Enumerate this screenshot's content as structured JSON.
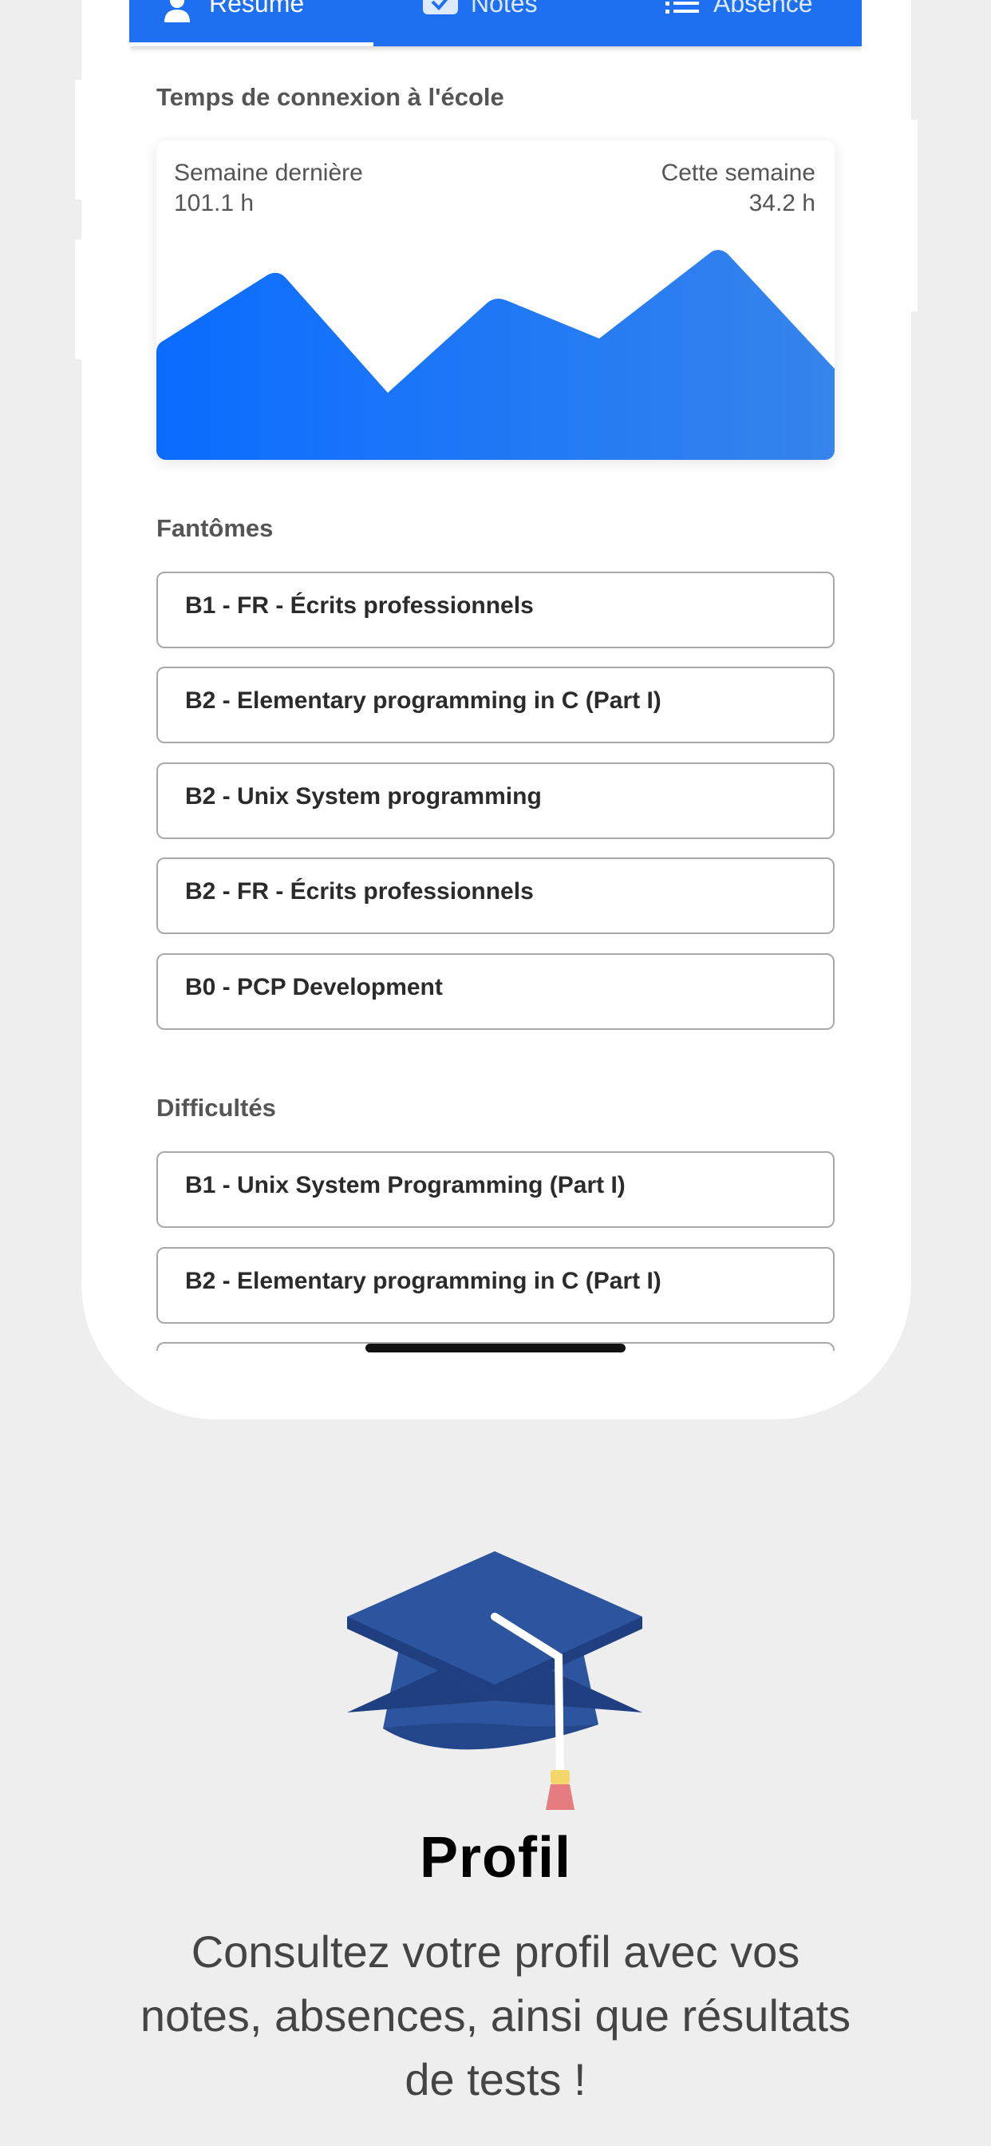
{
  "tabs": [
    {
      "label": "Résumé",
      "icon": "user-icon",
      "active": true
    },
    {
      "label": "Notes",
      "icon": "check-badge-icon",
      "active": false
    },
    {
      "label": "Absence",
      "icon": "list-icon",
      "active": false
    }
  ],
  "connection": {
    "title": "Temps de connexion à l'école",
    "last_week_label": "Semaine dernière",
    "last_week_value": "101.1 h",
    "this_week_label": "Cette semaine",
    "this_week_value": "34.2 h"
  },
  "fantomes": {
    "title": "Fantômes",
    "items": [
      "B1 - FR - Écrits professionnels",
      "B2 - Elementary programming in C (Part I)",
      "B2 - Unix System programming",
      "B2 - FR - Écrits professionnels",
      "B0 - PCP Development"
    ]
  },
  "difficultes": {
    "title": "Difficultés",
    "items": [
      "B1 - Unix System Programming (Part I)",
      "B2 - Elementary programming in C (Part I)"
    ]
  },
  "promo": {
    "title": "Profil",
    "text": "Consultez votre profil avec vos notes, absences, ainsi que résultats de tests !",
    "icon": "graduation-cap-icon"
  },
  "colors": {
    "accent": "#1e6ff1",
    "chart_start": "#0a6cff",
    "chart_end": "#3684ec"
  }
}
